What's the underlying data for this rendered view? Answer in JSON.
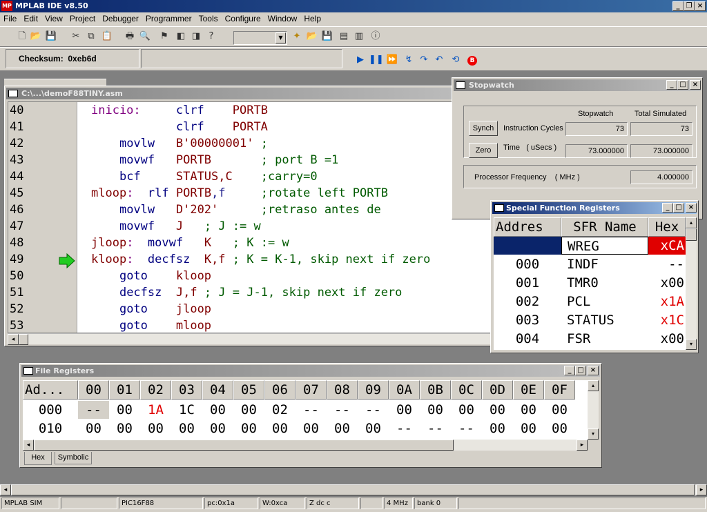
{
  "app": {
    "title": "MPLAB IDE v8.50"
  },
  "menu": [
    "File",
    "Edit",
    "View",
    "Project",
    "Debugger",
    "Programmer",
    "Tools",
    "Configure",
    "Window",
    "Help"
  ],
  "checksum_label": "Checksum:  0xeb6d",
  "editor": {
    "title": "C:\\...\\demoF88TINY.asm",
    "lines": [
      {
        "n": "40",
        "text": "inicio:     clrf    PORTB"
      },
      {
        "n": "41",
        "text": "            clrf    PORTA"
      },
      {
        "n": "42",
        "text": "    movlw   B'00000001' ;"
      },
      {
        "n": "43",
        "text": "    movwf   PORTB       ; port B =1"
      },
      {
        "n": "44",
        "text": "    bcf     STATUS,C    ;carry=0"
      },
      {
        "n": "45",
        "text": "mloop:  rlf PORTB,f     ;rotate left PORTB"
      },
      {
        "n": "46",
        "text": "    movlw   D'202'      ;retraso antes de"
      },
      {
        "n": "47",
        "text": "    movwf   J   ; J := w"
      },
      {
        "n": "48",
        "text": "jloop:  movwf   K   ; K := w"
      },
      {
        "n": "49",
        "text": "kloop:  decfsz  K,f ; K = K-1, skip next if zero"
      },
      {
        "n": "50",
        "text": "    goto    kloop"
      },
      {
        "n": "51",
        "text": "    decfsz  J,f ; J = J-1, skip next if zero"
      },
      {
        "n": "52",
        "text": "    goto    jloop"
      },
      {
        "n": "53",
        "text": "    goto    mloop"
      }
    ]
  },
  "stopwatch": {
    "title": "Stopwatch",
    "col_stopwatch": "Stopwatch",
    "col_total": "Total Simulated",
    "synch": "Synch",
    "zero": "Zero",
    "cycles_label": "Instruction Cycles",
    "time_label": "Time   ( uSecs )",
    "cycles_sw": "73",
    "cycles_total": "73",
    "time_sw": "73.000000",
    "time_total": "73.000000",
    "freq_label": "Processor Frequency    ( MHz )",
    "freq": "4.000000"
  },
  "sfr": {
    "title": "Special Function Registers",
    "headers": [
      "Addres",
      "SFR Name",
      "Hex"
    ],
    "rows": [
      {
        "addr": "",
        "name": "WREG",
        "hex": "xCA"
      },
      {
        "addr": "000",
        "name": "INDF",
        "hex": "--"
      },
      {
        "addr": "001",
        "name": "TMR0",
        "hex": "x00"
      },
      {
        "addr": "002",
        "name": "PCL",
        "hex": "x1A"
      },
      {
        "addr": "003",
        "name": "STATUS",
        "hex": "x1C"
      },
      {
        "addr": "004",
        "name": "FSR",
        "hex": "x00"
      }
    ]
  },
  "fileregs": {
    "title": "File Registers",
    "headers": [
      "Ad...",
      "00",
      "01",
      "02",
      "03",
      "04",
      "05",
      "06",
      "07",
      "08",
      "09",
      "0A",
      "0B",
      "0C",
      "0D",
      "0E",
      "0F"
    ],
    "rows": [
      [
        "000",
        "--",
        "00",
        "1A",
        "1C",
        "00",
        "00",
        "02",
        "--",
        "--",
        "--",
        "00",
        "00",
        "00",
        "00",
        "00",
        "00"
      ],
      [
        "010",
        "00",
        "00",
        "00",
        "00",
        "00",
        "00",
        "00",
        "00",
        "00",
        "00",
        "--",
        "--",
        "--",
        "00",
        "00",
        "00"
      ]
    ],
    "tabs": [
      "Hex",
      "Symbolic"
    ]
  },
  "status": [
    "MPLAB SIM",
    "PIC16F88",
    "pc:0x1a",
    "W:0xca",
    "Z dc c",
    "",
    "4 MHz",
    "bank 0"
  ]
}
